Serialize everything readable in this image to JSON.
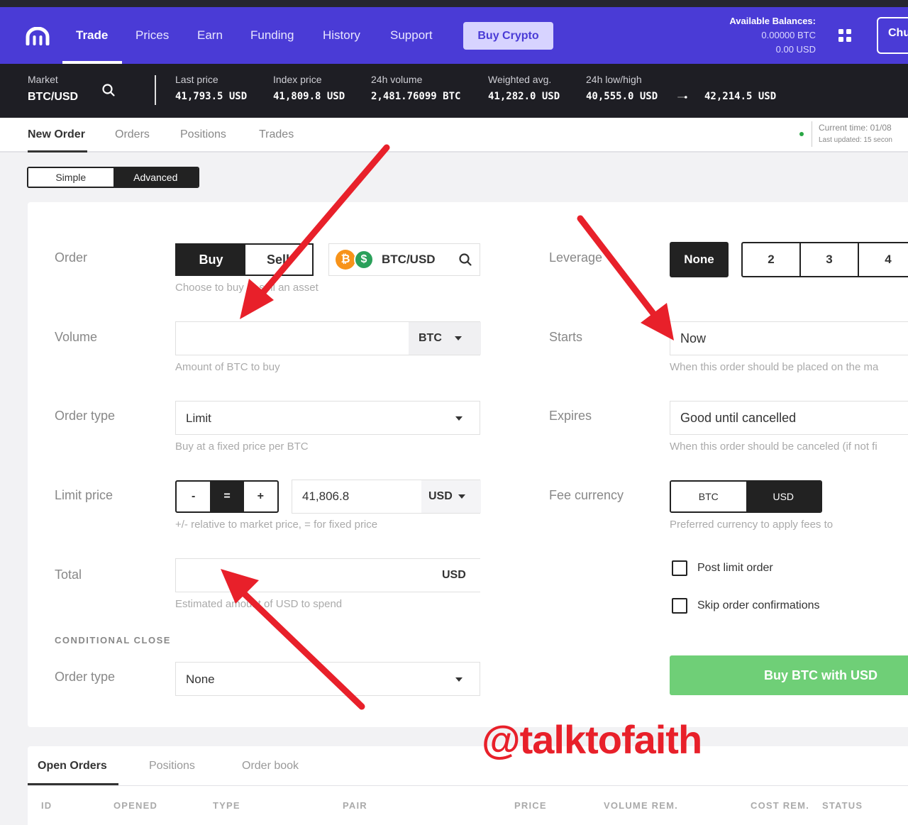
{
  "nav": {
    "items": [
      "Trade",
      "Prices",
      "Earn",
      "Funding",
      "History",
      "Support"
    ],
    "buy_crypto": "Buy Crypto",
    "balances_title": "Available Balances:",
    "balance_btc": "0.00000 BTC",
    "balance_usd": "0.00 USD",
    "user_label": "Chu"
  },
  "ticker": {
    "market_label": "Market",
    "market_value": "BTC/USD",
    "last_price_label": "Last price",
    "last_price": "41,793.5 USD",
    "index_price_label": "Index price",
    "index_price": "41,809.8 USD",
    "volume_label": "24h volume",
    "volume": "2,481.76099 BTC",
    "wavg_label": "Weighted avg.",
    "wavg": "41,282.0 USD",
    "lowhigh_label": "24h low/high",
    "low": "40,555.0 USD",
    "high": "42,214.5 USD"
  },
  "tabs": [
    "New Order",
    "Orders",
    "Positions",
    "Trades"
  ],
  "status": {
    "current_time": "Current time: 01/08",
    "last_updated": "Last updated: 15 secon"
  },
  "mode": {
    "simple": "Simple",
    "advanced": "Advanced"
  },
  "form": {
    "order_label": "Order",
    "buy": "Buy",
    "sell": "Sell",
    "order_hint": "Choose to buy or sell an asset",
    "pair": "BTC/USD",
    "volume_label": "Volume",
    "volume_value": "",
    "volume_unit": "BTC",
    "volume_hint": "Amount of BTC to buy",
    "order_type_label": "Order type",
    "order_type_value": "Limit",
    "order_type_hint": "Buy at a fixed price per BTC",
    "limit_price_label": "Limit price",
    "stepper_minus": "-",
    "stepper_eq": "=",
    "stepper_plus": "+",
    "limit_price_value": "41,806.8",
    "limit_price_unit": "USD",
    "limit_price_hint": "+/- relative to market price, = for fixed price",
    "total_label": "Total",
    "total_value": "",
    "total_unit": "USD",
    "total_hint": "Estimated amount of USD to spend",
    "conditional_close": "CONDITIONAL CLOSE",
    "close_type_label": "Order type",
    "close_type_value": "None",
    "leverage_label": "Leverage",
    "leverage_options": [
      "None",
      "2",
      "3",
      "4"
    ],
    "starts_label": "Starts",
    "starts_value": "Now",
    "starts_hint": "When this order should be placed on the ma",
    "expires_label": "Expires",
    "expires_value": "Good until cancelled",
    "expires_hint": "When this order should be canceled (if not fi",
    "fee_label": "Fee currency",
    "fee_btc": "BTC",
    "fee_usd": "USD",
    "fee_hint": "Preferred currency to apply fees to",
    "post_limit": "Post limit order",
    "skip_confirm": "Skip order confirmations",
    "submit": "Buy BTC with USD"
  },
  "bottom": {
    "tabs": [
      "Open Orders",
      "Positions",
      "Order book"
    ],
    "columns": [
      "ID",
      "OPENED",
      "TYPE",
      "PAIR",
      "PRICE",
      "VOLUME REM.",
      "COST REM.",
      "STATUS"
    ]
  },
  "watermark": "@talktofaith",
  "colors": {
    "nav_bg": "#4a3bd6",
    "ticker_bg": "#1e1e24",
    "submit_green": "#6fcf77",
    "arrow_red": "#e8202a"
  }
}
